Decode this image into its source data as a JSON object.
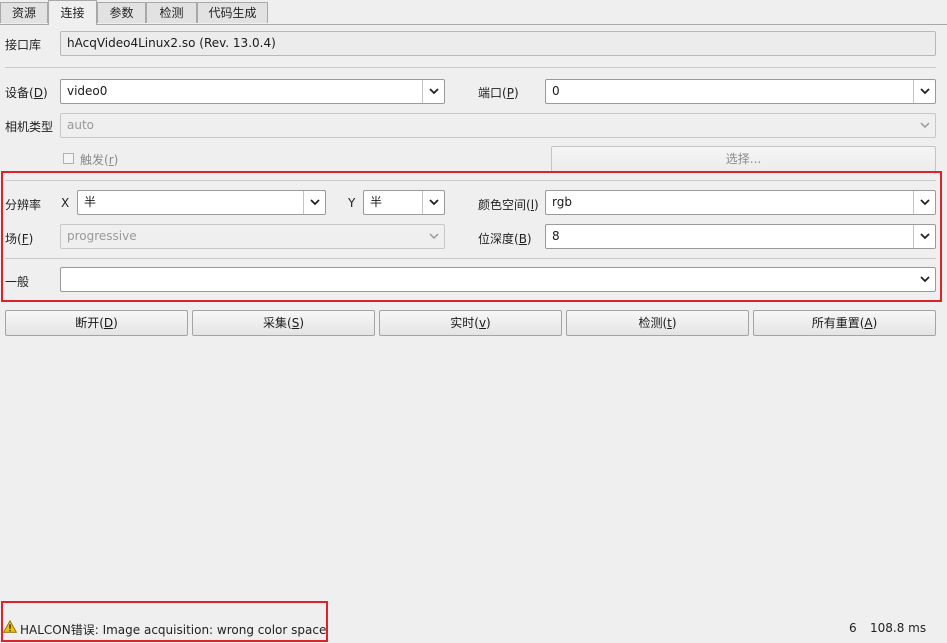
{
  "tabs": [
    {
      "label": "资源"
    },
    {
      "label": "连接"
    },
    {
      "label": "参数"
    },
    {
      "label": "检测"
    },
    {
      "label": "代码生成"
    }
  ],
  "interface": {
    "label": "接口库",
    "value": "hAcqVideo4Linux2.so (Rev. 13.0.4)"
  },
  "device": {
    "label": "设备(",
    "mnemonic": "D",
    "suffix": ")",
    "value": "video0"
  },
  "port": {
    "label": "端口(",
    "mnemonic": "P",
    "suffix": ")",
    "value": "0"
  },
  "camera_type": {
    "label": "相机类型",
    "value": "auto"
  },
  "trigger": {
    "label": "触发(",
    "mnemonic": "r",
    "suffix": ")",
    "checked": false
  },
  "select_button": {
    "label": "选择..."
  },
  "resolution": {
    "label": "分辨率",
    "x_label": "X",
    "x_value": "半",
    "y_label": "Y",
    "y_value": "半"
  },
  "color_space": {
    "label": "颜色空间(",
    "mnemonic": "l",
    "suffix": ")",
    "value": "rgb"
  },
  "field": {
    "label": "场(",
    "mnemonic": "F",
    "suffix": ")",
    "value": "progressive"
  },
  "bit_depth": {
    "label": "位深度(",
    "mnemonic": "B",
    "suffix": ")",
    "value": "8"
  },
  "general": {
    "label": "一般",
    "value": ""
  },
  "buttons": [
    {
      "label": "断开(",
      "mnemonic": "D",
      "suffix": ")"
    },
    {
      "label": "采集(",
      "mnemonic": "S",
      "suffix": ")"
    },
    {
      "label": "实时(",
      "mnemonic": "v",
      "suffix": ")"
    },
    {
      "label": "检测(",
      "mnemonic": "t",
      "suffix": ")"
    },
    {
      "label": "所有重置(",
      "mnemonic": "A",
      "suffix": ")"
    }
  ],
  "status": {
    "message": "HALCON错误: Image acquisition: wrong color space",
    "count": "6",
    "time": "108.8 ms",
    "icon": "warning-icon"
  },
  "colors": {
    "highlight": "#e0202a",
    "warning": "#f2c200"
  }
}
